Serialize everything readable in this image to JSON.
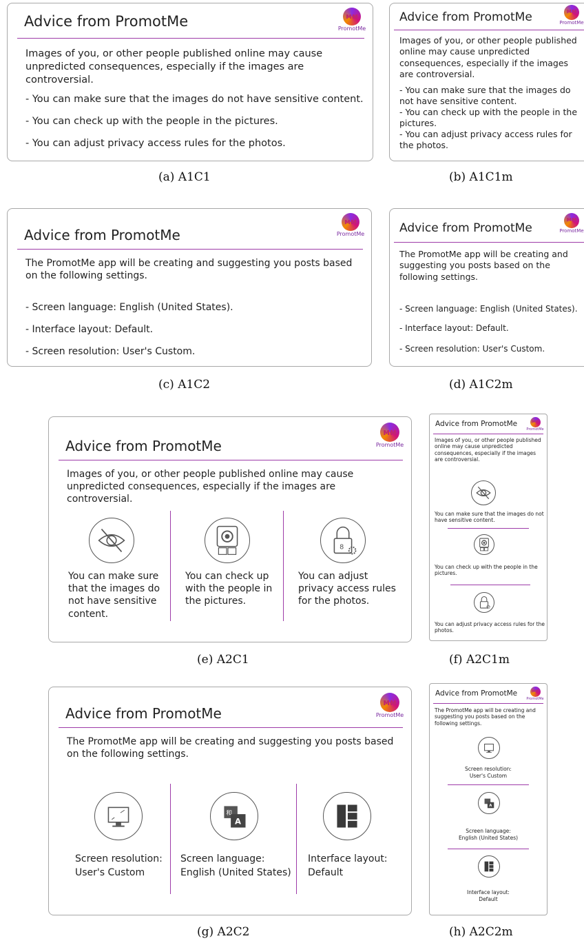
{
  "title": "Advice from PromotMe",
  "logo_text": "PromotMe",
  "colors": {
    "accent": "#9d3aa8",
    "border": "#a8a8a8",
    "icon_stroke": "#555555"
  },
  "images_text": {
    "intro": "Images of you, or other people published online may cause unpredicted consequences, especially if the images are controversial.",
    "b1": "- You can make sure that the images do not have sensitive content.",
    "b2": "- You can check up with the people in the pictures.",
    "b3": "- You can adjust privacy access rules for the photos.",
    "s1": "You can make sure that the images do not have sensitive content.",
    "s2": "You can check up with the people in the pictures.",
    "s3": "You can adjust privacy access rules for the photos."
  },
  "settings_text": {
    "intro": "The PromotMe app will be creating and suggesting you posts based on the following settings.",
    "b1": "- Screen language: English (United States).",
    "b2": "- Interface layout: Default.",
    "b3": "- Screen resolution: User's Custom.",
    "res_label": "Screen resolution:",
    "res_value": "User's Custom",
    "lang_label": "Screen language:",
    "lang_value": "English (United States)",
    "layout_label": "Interface layout:",
    "layout_value": "Default"
  },
  "captions": {
    "a": "(a) A1C1",
    "b": "(b) A1C1m",
    "c": "(c) A1C2",
    "d": "(d) A1C2m",
    "e": "(e) A2C1",
    "f": "(f) A2C1m",
    "g": "(g) A2C2",
    "h": "(h) A2C2m"
  },
  "icons": [
    "eye-slash-icon",
    "photo-people-icon",
    "lock-gear-icon",
    "monitor-icon",
    "language-icon",
    "layout-icon"
  ]
}
